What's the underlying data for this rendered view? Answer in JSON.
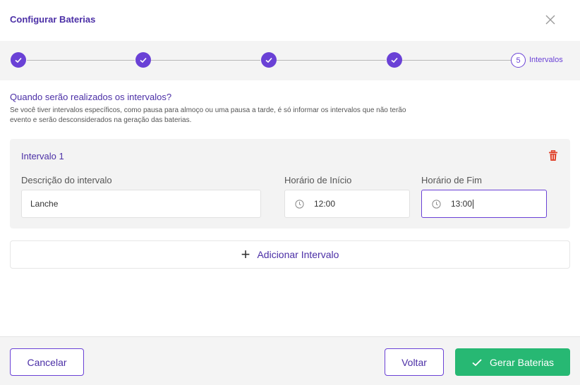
{
  "dialog": {
    "title": "Configurar Baterias"
  },
  "stepper": {
    "current_step_number": "5",
    "current_step_label": "Intervalos",
    "completed_steps": 4
  },
  "intro": {
    "question": "Quando serão realizados os intervalos?",
    "description": "Se você tiver intervalos específicos, como pausa para almoço ou uma pausa a tarde, é só informar  os intervalos que não terão evento e serão desconsiderados na geração das baterias."
  },
  "intervals": [
    {
      "title": "Intervalo 1",
      "description_label": "Descrição do intervalo",
      "description_value": "Lanche",
      "start_label": "Horário de Início",
      "start_value": "12:00",
      "end_label": "Horário de Fim",
      "end_value": "13:00"
    }
  ],
  "add_interval_label": "Adicionar Intervalo",
  "footer": {
    "cancel_label": "Cancelar",
    "back_label": "Voltar",
    "generate_label": "Gerar Baterias"
  },
  "colors": {
    "accent": "#6a41d6",
    "title": "#4b2fa6",
    "success": "#27b873",
    "danger": "#e0452e"
  },
  "icons": {
    "close": "close-icon",
    "check": "check-icon",
    "trash": "trash-icon",
    "clock": "clock-icon",
    "plus": "plus-icon"
  }
}
